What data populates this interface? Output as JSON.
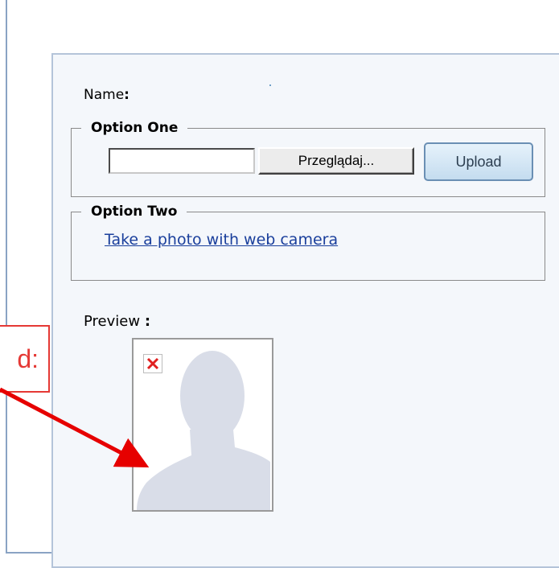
{
  "form": {
    "name_label": "Name",
    "name_colon": ":"
  },
  "option_one": {
    "legend": "Option One",
    "file_input_value": "",
    "browse_label": "Przeglądaj...",
    "upload_label": "Upload"
  },
  "option_two": {
    "legend": "Option Two",
    "camera_link": "Take a photo with web camera"
  },
  "preview": {
    "label": "Preview",
    "colon": ":",
    "placeholder_icon": "avatar-silhouette-icon",
    "broken_icon": "broken-image-icon"
  },
  "callout": {
    "text": "d:",
    "color": "#e53935"
  }
}
